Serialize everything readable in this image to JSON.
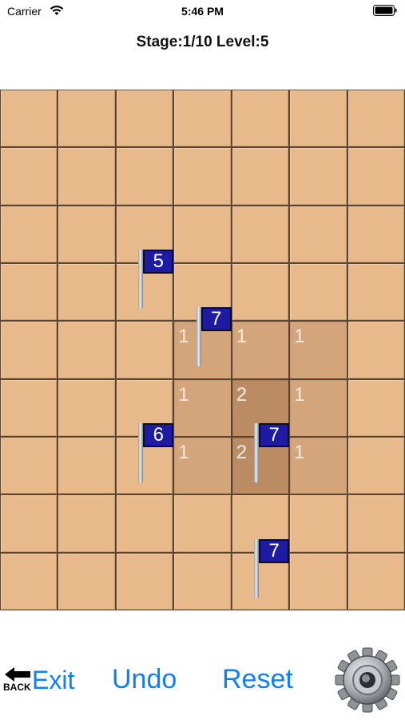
{
  "status_bar": {
    "carrier": "Carrier",
    "time": "5:46 PM"
  },
  "header": {
    "title": "Stage:1/10 Level:5"
  },
  "board": {
    "cols": 7,
    "rows": 9,
    "dug_cells": [
      {
        "r": 4,
        "c": 3,
        "depth": 1
      },
      {
        "r": 4,
        "c": 4,
        "depth": 1
      },
      {
        "r": 4,
        "c": 5,
        "depth": 1
      },
      {
        "r": 5,
        "c": 3,
        "depth": 1
      },
      {
        "r": 5,
        "c": 4,
        "depth": 2
      },
      {
        "r": 5,
        "c": 5,
        "depth": 1
      },
      {
        "r": 6,
        "c": 3,
        "depth": 1
      },
      {
        "r": 6,
        "c": 4,
        "depth": 2
      },
      {
        "r": 6,
        "c": 5,
        "depth": 1
      }
    ],
    "numbers": [
      {
        "r": 4,
        "c": 3,
        "value": "1"
      },
      {
        "r": 4,
        "c": 4,
        "value": "1"
      },
      {
        "r": 4,
        "c": 5,
        "value": "1"
      },
      {
        "r": 5,
        "c": 3,
        "value": "1"
      },
      {
        "r": 5,
        "c": 4,
        "value": "2"
      },
      {
        "r": 5,
        "c": 5,
        "value": "1"
      },
      {
        "r": 6,
        "c": 3,
        "value": "1"
      },
      {
        "r": 6,
        "c": 4,
        "value": "2"
      },
      {
        "r": 6,
        "c": 5,
        "value": "1"
      }
    ],
    "flags": [
      {
        "r": 3,
        "c": 2,
        "value": "5"
      },
      {
        "r": 4,
        "c": 3,
        "value": "7"
      },
      {
        "r": 6,
        "c": 2,
        "value": "6"
      },
      {
        "r": 6,
        "c": 4,
        "value": "7"
      },
      {
        "r": 8,
        "c": 4,
        "value": "7"
      }
    ]
  },
  "bottom": {
    "back_label": "BACK",
    "exit_label": "Exit",
    "undo_label": "Undo",
    "reset_label": "Reset",
    "icons": {
      "back": "back-arrow-icon",
      "settings": "gear-icon"
    }
  },
  "colors": {
    "accent": "#0f7ff5",
    "tile": "#e8b98a",
    "tile_dug": "#d4a47a",
    "tile_dug_deep": "#bb8c64",
    "grid": "#5a4431",
    "flag": "#1f1aa3"
  }
}
